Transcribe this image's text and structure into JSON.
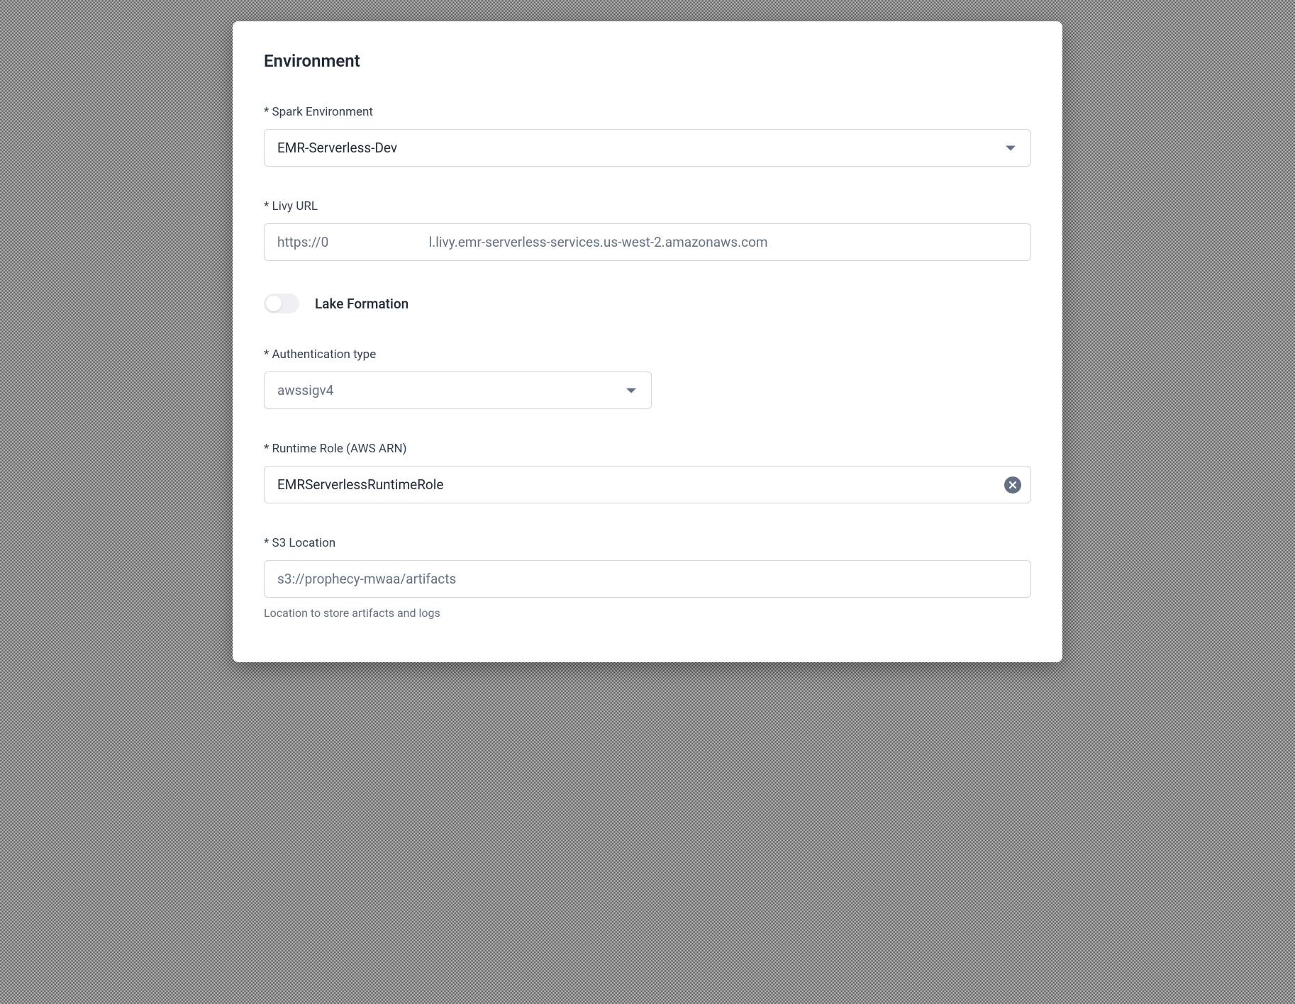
{
  "section": {
    "title": "Environment"
  },
  "fields": {
    "spark_env": {
      "label": "* Spark Environment",
      "value": "EMR-Serverless-Dev"
    },
    "livy_url": {
      "label": "* Livy URL",
      "value": "https://0                              l.livy.emr-serverless-services.us-west-2.amazonaws.com"
    },
    "lake_formation": {
      "label": "Lake Formation",
      "enabled": false
    },
    "auth_type": {
      "label": "* Authentication type",
      "value": "awssigv4"
    },
    "runtime_role": {
      "label": "* Runtime Role (AWS ARN)",
      "value": "EMRServerlessRuntimeRole"
    },
    "s3_location": {
      "label": "* S3 Location",
      "value": "s3://prophecy-mwaa/artifacts",
      "help": "Location to store artifacts and logs"
    }
  }
}
